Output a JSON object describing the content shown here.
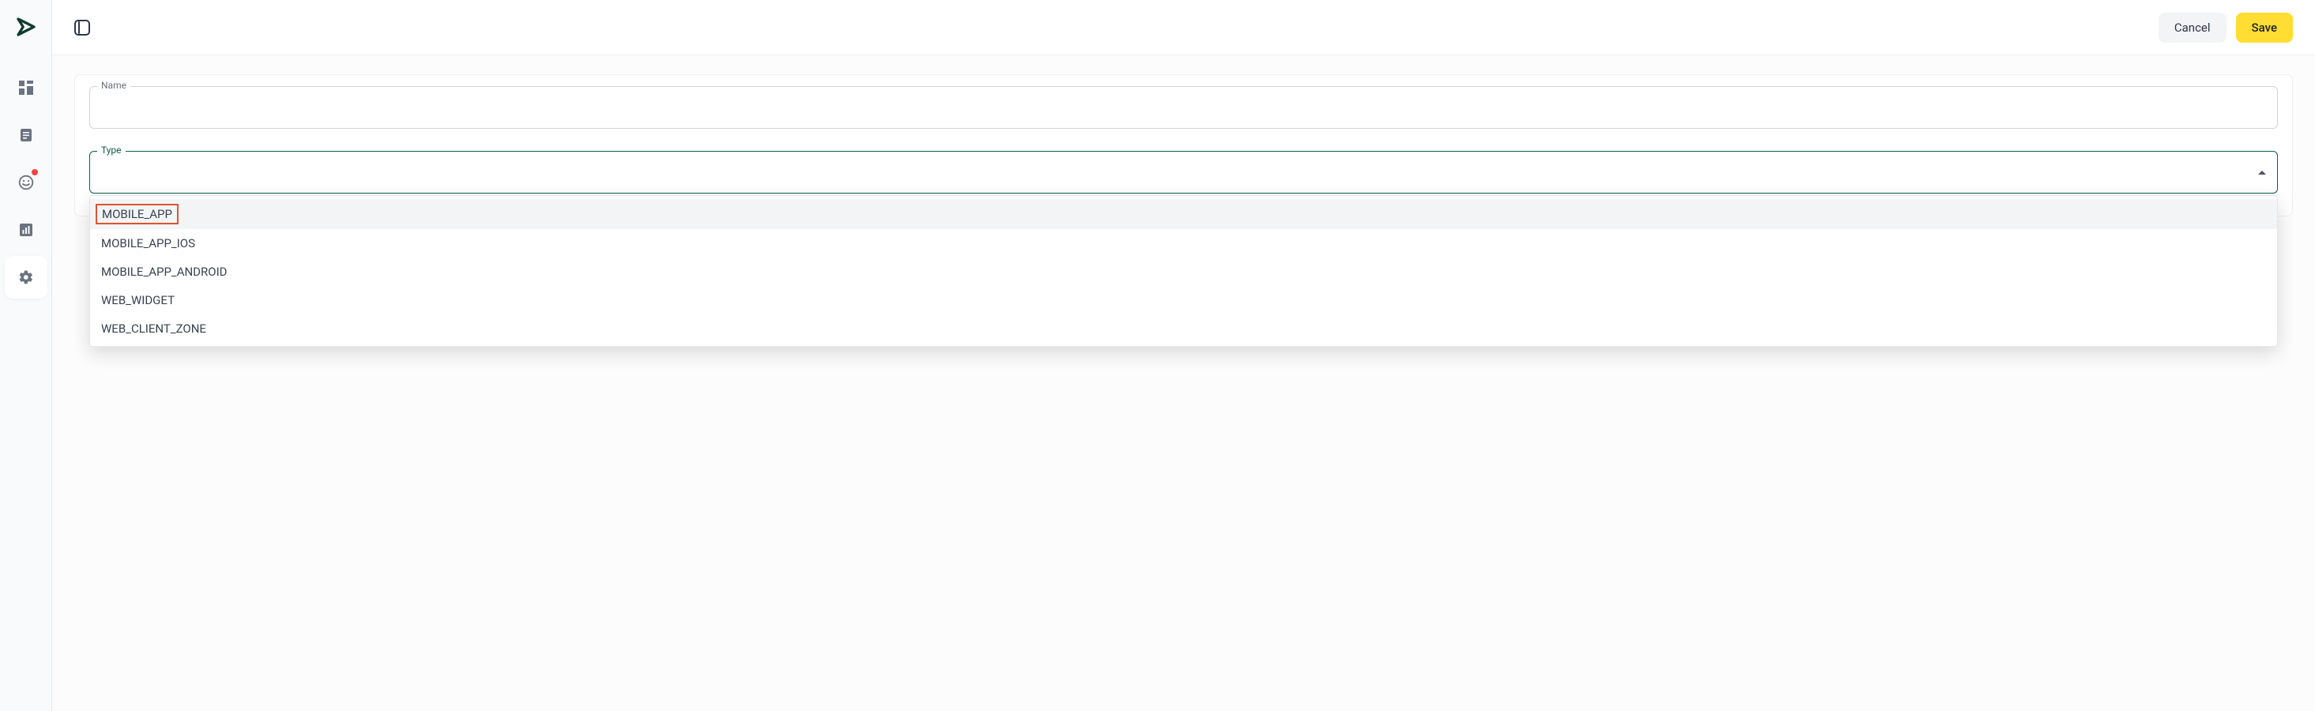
{
  "topbar": {
    "cancel_label": "Cancel",
    "save_label": "Save"
  },
  "form": {
    "name_label": "Name",
    "name_value": "",
    "type_label": "Type",
    "type_value": ""
  },
  "type_options": [
    "MOBILE_APP",
    "MOBILE_APP_IOS",
    "MOBILE_APP_ANDROID",
    "WEB_WIDGET",
    "WEB_CLIENT_ZONE"
  ],
  "sidebar_icons": [
    "dashboard-icon",
    "doc-icon",
    "smile-icon",
    "chart-icon",
    "gear-icon"
  ],
  "colors": {
    "accent": "#0f5d4a",
    "save_bg": "#ffdd33",
    "highlight_border": "#e0532f"
  }
}
